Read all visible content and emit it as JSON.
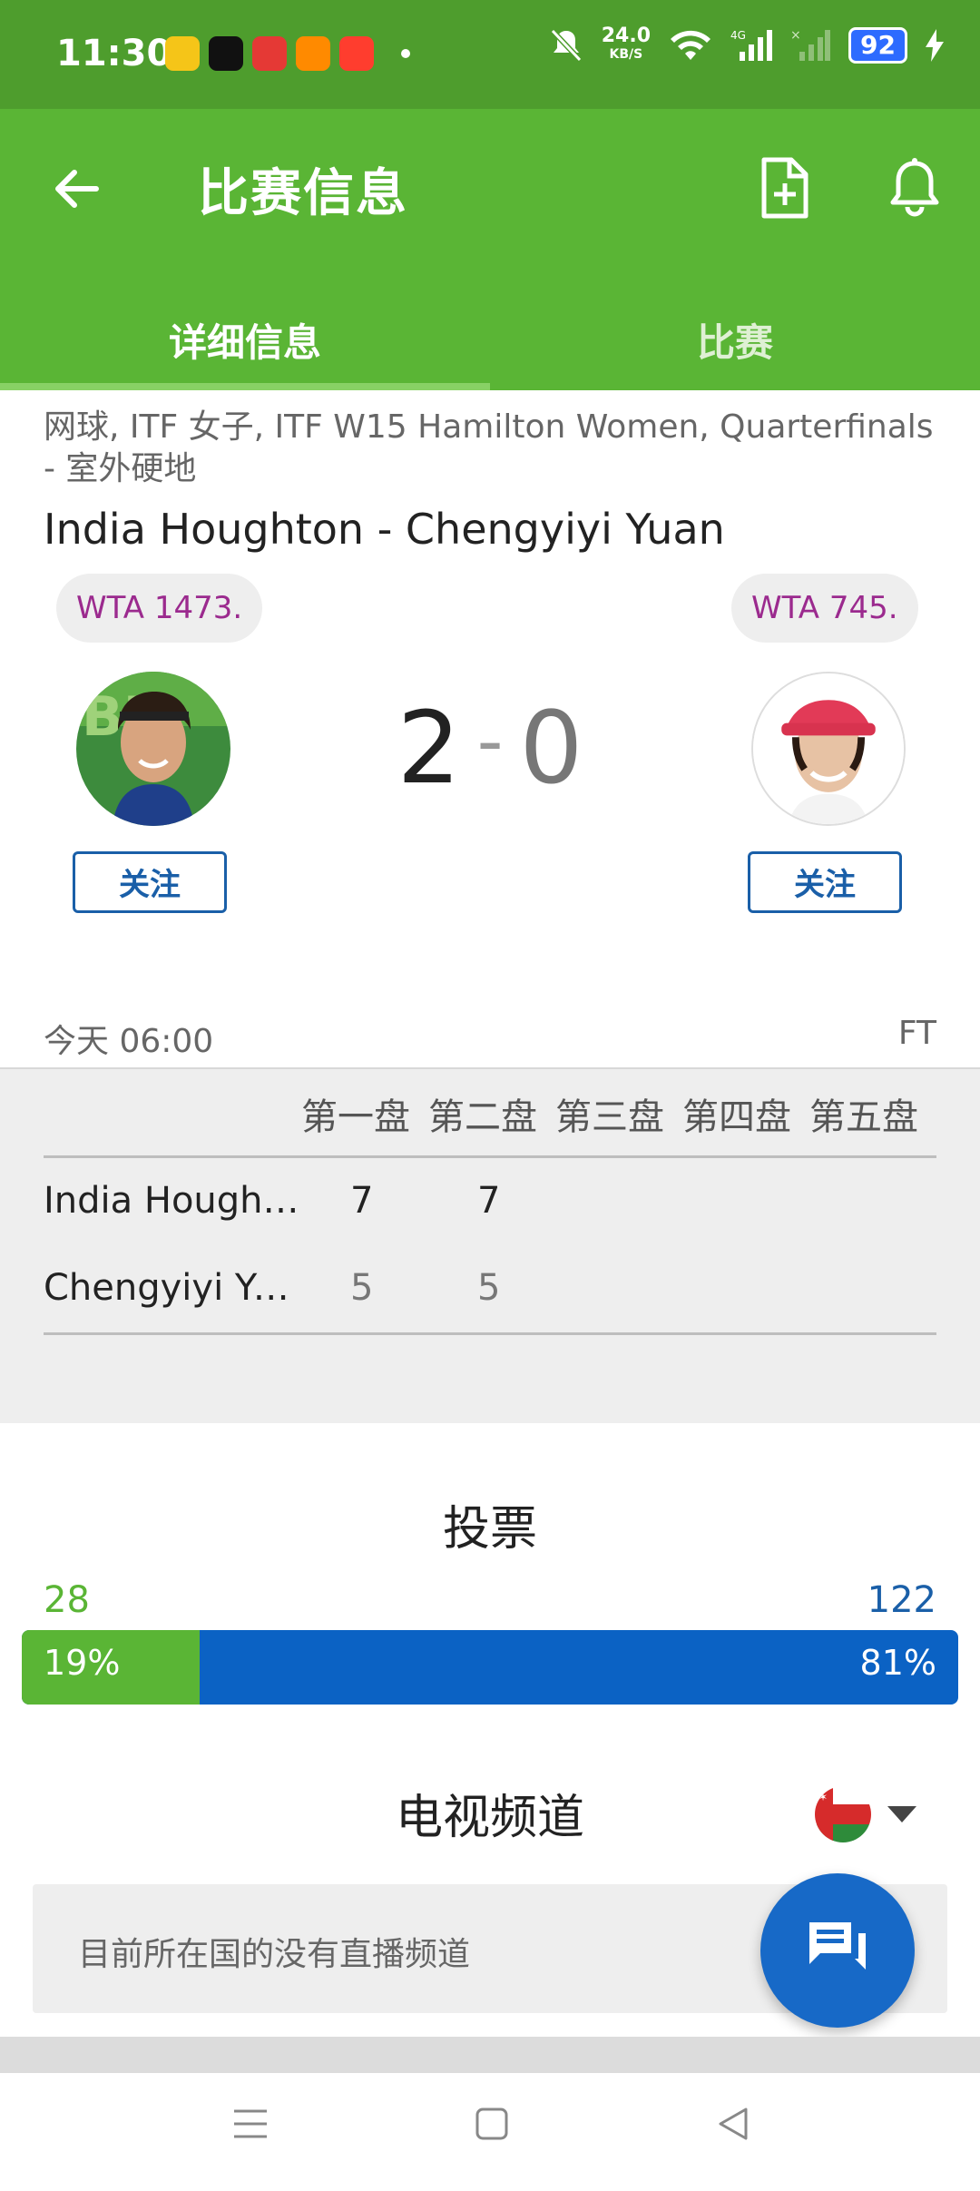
{
  "status_bar": {
    "time": "11:30",
    "net_speed_value": "24.0",
    "net_speed_unit": "KB/S",
    "battery": "92"
  },
  "app_bar": {
    "title": "比赛信息",
    "tabs": [
      {
        "label": "详细信息",
        "active": true
      },
      {
        "label": "比赛",
        "active": false
      }
    ]
  },
  "match": {
    "meta": "网球, ITF 女子, ITF W15 Hamilton Women, Quarterfinals - 室外硬地",
    "title": "India Houghton - Chengyiyi Yuan",
    "home": {
      "rank": "WTA 1473.",
      "follow_label": "关注",
      "score": "2"
    },
    "away": {
      "rank": "WTA 745.",
      "follow_label": "关注",
      "score": "0"
    },
    "score_separator": "-",
    "date": "今天 06:00",
    "status": "FT"
  },
  "sets": {
    "headers": [
      "第一盘",
      "第二盘",
      "第三盘",
      "第四盘",
      "第五盘"
    ],
    "rows": [
      {
        "player": "India Houghton",
        "scores": [
          "7",
          "7"
        ]
      },
      {
        "player": "Chengyiyi Yuan",
        "scores": [
          "5",
          "5"
        ]
      }
    ]
  },
  "vote": {
    "title": "投票",
    "home_count": "28",
    "away_count": "122",
    "home_pct": "19%",
    "away_pct": "81%",
    "home_fraction": 0.19,
    "colors": {
      "home": "#5ab535",
      "away": "#0b62c4"
    }
  },
  "tv": {
    "title": "电视频道",
    "message": "目前所在国的没有直播频道",
    "flag_icon": "oman-flag-icon"
  }
}
